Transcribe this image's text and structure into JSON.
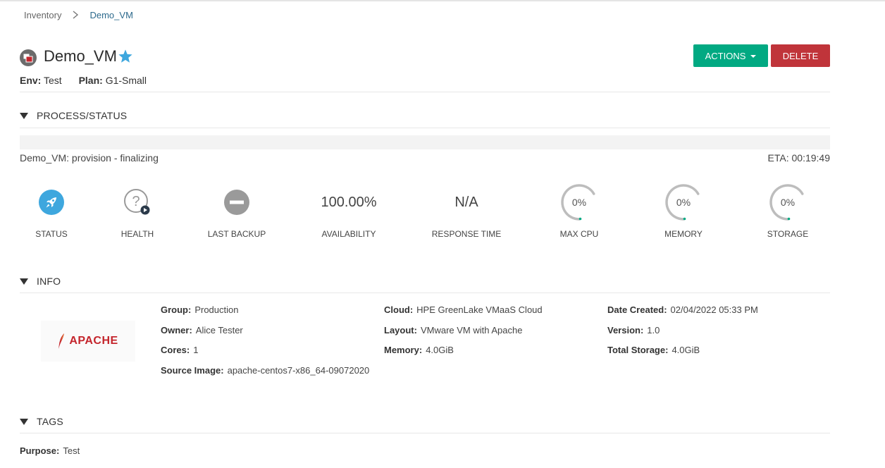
{
  "breadcrumb": {
    "parent": "Inventory",
    "current": "Demo_VM"
  },
  "header": {
    "title": "Demo_VM",
    "env_label": "Env:",
    "env_value": "Test",
    "plan_label": "Plan:",
    "plan_value": "G1-Small",
    "actions_label": "ACTIONS",
    "delete_label": "DELETE",
    "accent": "#01a982",
    "danger": "#c0343a",
    "star_color": "#3ea7de"
  },
  "process": {
    "section_title": "PROCESS/STATUS",
    "progress_text": "Demo_VM: provision - finalizing",
    "eta": "ETA: 00:19:49"
  },
  "stats": [
    {
      "label": "STATUS",
      "icon": "rocket-icon"
    },
    {
      "label": "HEALTH",
      "icon": "question-icon"
    },
    {
      "label": "LAST BACKUP",
      "icon": "minus-circle-icon"
    },
    {
      "label": "AVAILABILITY",
      "value": "100.00%"
    },
    {
      "label": "RESPONSE TIME",
      "value": "N/A"
    },
    {
      "label": "MAX CPU",
      "value": "0%"
    },
    {
      "label": "MEMORY",
      "value": "0%"
    },
    {
      "label": "STORAGE",
      "value": "0%"
    }
  ],
  "info": {
    "section_title": "INFO",
    "logo_text": "APACHE",
    "col1": [
      {
        "k": "Group:",
        "v": "Production"
      },
      {
        "k": "Owner:",
        "v": "Alice Tester"
      },
      {
        "k": "Cores:",
        "v": "1"
      },
      {
        "k": "Source Image:",
        "v": "apache-centos7-x86_64-09072020"
      }
    ],
    "col2": [
      {
        "k": "Cloud:",
        "v": "HPE GreenLake VMaaS Cloud"
      },
      {
        "k": "Layout:",
        "v": "VMware VM with Apache"
      },
      {
        "k": "Memory:",
        "v": "4.0GiB"
      }
    ],
    "col3": [
      {
        "k": "Date Created:",
        "v": "02/04/2022 05:33 PM"
      },
      {
        "k": "Version:",
        "v": "1.0"
      },
      {
        "k": "Total Storage:",
        "v": "4.0GiB"
      }
    ]
  },
  "tags": {
    "section_title": "TAGS",
    "items": [
      {
        "k": "Purpose:",
        "v": "Test"
      }
    ]
  }
}
